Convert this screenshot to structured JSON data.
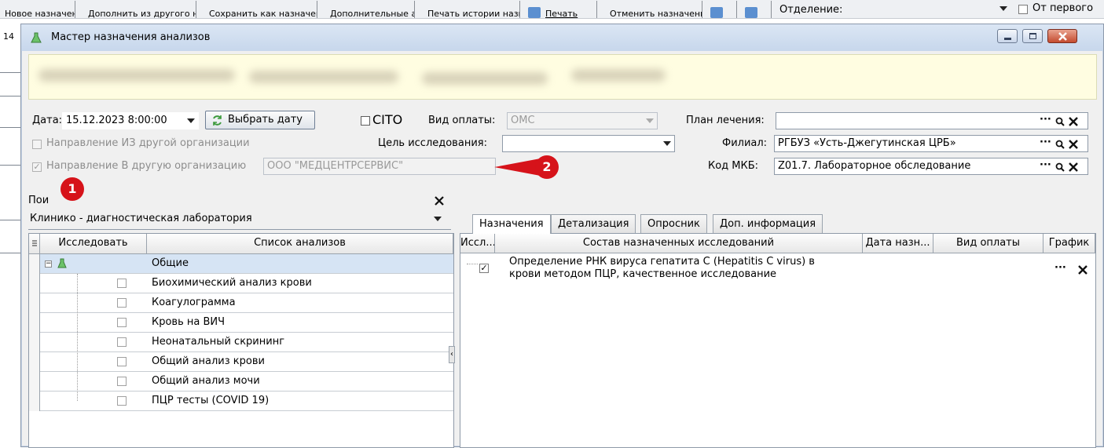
{
  "background_toolbar": {
    "items": [
      {
        "label": "Новое назначение",
        "icon": "new-icon"
      },
      {
        "label": "Дополнить из другого назначения",
        "icon": "folder-icon"
      },
      {
        "label": "Сохранить как назначение",
        "icon": "save-icon"
      },
      {
        "label": "Дополнительные анализы",
        "icon": "tests-icon"
      },
      {
        "label": "Печать истории назначений",
        "icon": "history-icon"
      },
      {
        "label": "Печать",
        "icon": "print-icon"
      },
      {
        "label": "Отменить назначение",
        "icon": "cancel-icon"
      },
      {
        "label": "",
        "icon": "arrow-left-icon"
      },
      {
        "label": "",
        "icon": "arrow-right-icon"
      }
    ],
    "department_label": "Отделение:",
    "from_first_label": "От первого",
    "left_strip_text": "14"
  },
  "dialog": {
    "title": "Мастер назначения анализов",
    "date_label": "Дата:",
    "date_value": "15.12.2023 8:00:00",
    "pick_date_button": "Выбрать дату",
    "cito_label": "CITO",
    "payment_label": "Вид оплаты:",
    "payment_value": "ОМС",
    "treatment_plan_label": "План лечения:",
    "treatment_plan_value": "",
    "referral_from_label": "Направление ИЗ другой организации",
    "purpose_label": "Цель исследования:",
    "purpose_value": "",
    "branch_label": "Филиал:",
    "branch_value": "РГБУЗ «Усть-Джегутинская ЦРБ»",
    "referral_to_label": "Направление В другую организацию",
    "referral_to_value": "ООО \"МЕДЦЕНТРСЕРВИС\"",
    "mkb_label": "Код МКБ:",
    "mkb_value": "Z01.7. Лабораторное обследование",
    "dots": "···",
    "markers": [
      "1",
      "2"
    ]
  },
  "left": {
    "search_label": "Пои",
    "lab_value": "Клинико - диагностическая лаборатория",
    "columns": [
      "Исследовать",
      "Список анализов"
    ],
    "group": "Общие",
    "items": [
      "Биохимический анализ крови",
      "Коагулограмма",
      "Кровь на ВИЧ",
      "Неонатальный скрининг",
      "Общий анализ крови",
      "Общий анализ мочи",
      "ПЦР тесты (COVID 19)"
    ]
  },
  "tabs": [
    "Назначения",
    "Детализация",
    "Опросник",
    "Доп. информация"
  ],
  "right": {
    "columns": [
      "Иссл...",
      "Состав назначенных исследований",
      "Дата назн...",
      "Вид оплаты",
      "График"
    ],
    "rows": [
      {
        "checked": true,
        "text_line1": "Определение РНК вируса гепатита С (Hepatitis C virus) в",
        "text_line2": "крови методом ПЦР, качественное исследование"
      }
    ]
  },
  "colors": {
    "marker": "#d6131a",
    "info_band": "#fffde1",
    "title_gradient": "#c7d7ec"
  }
}
